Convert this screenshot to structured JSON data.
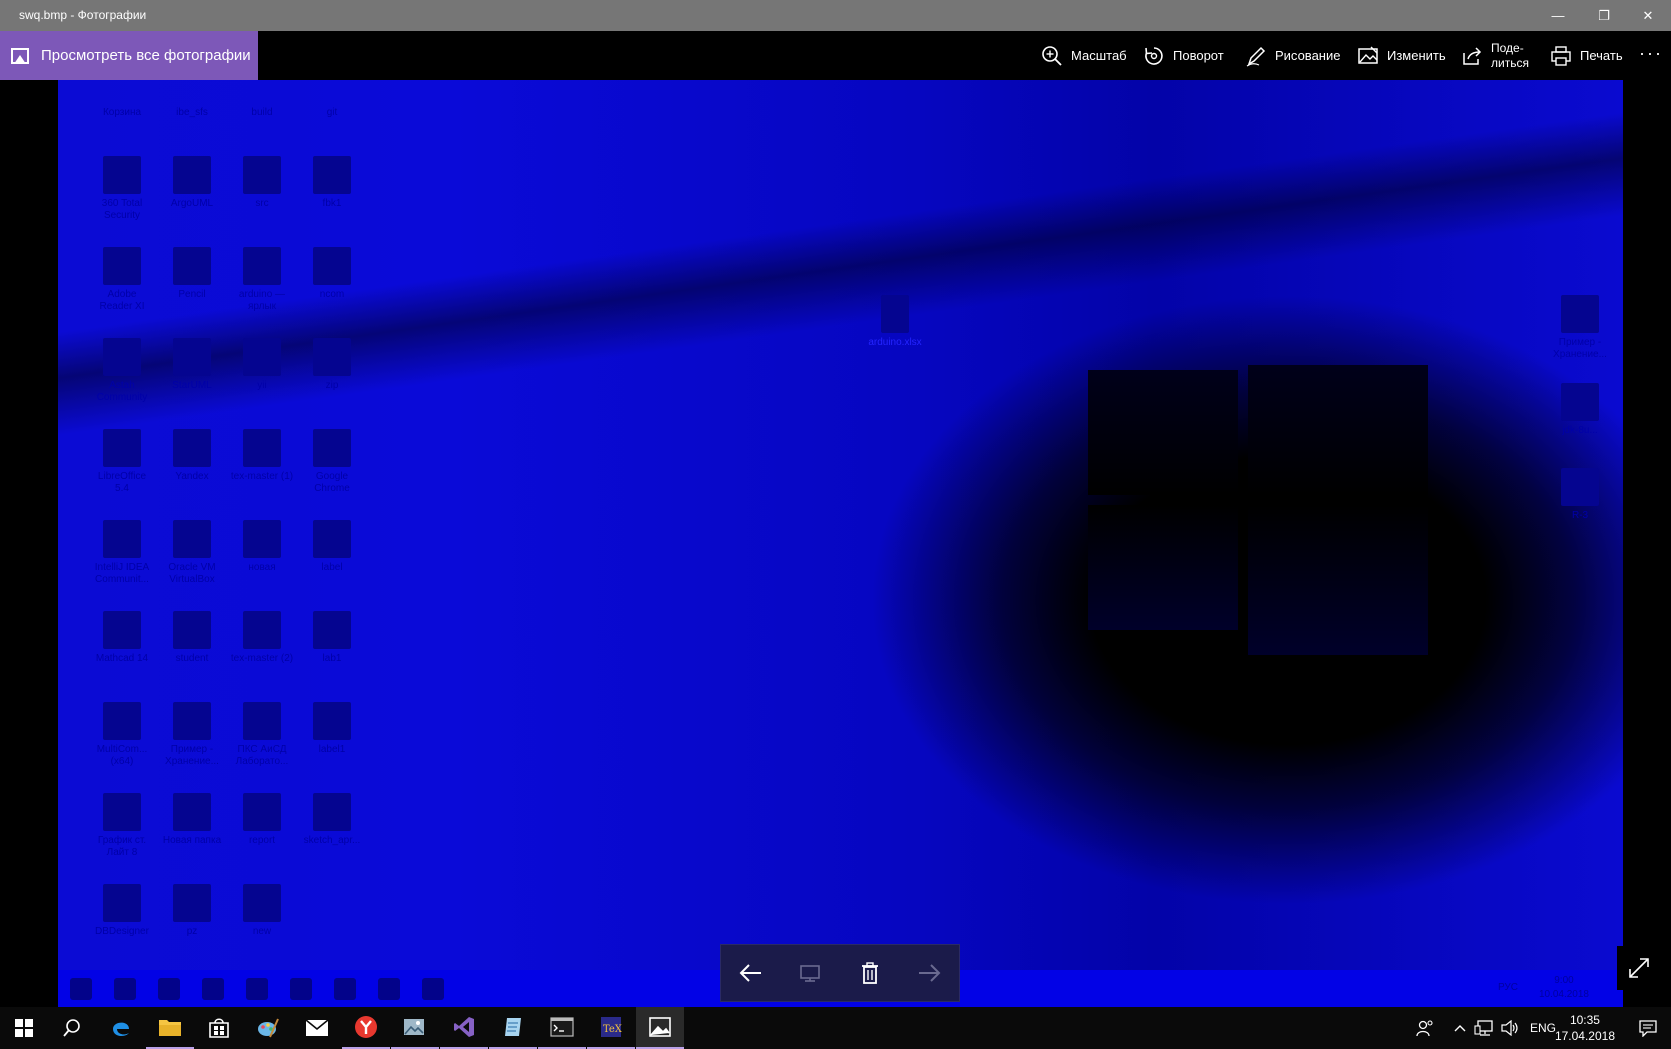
{
  "window": {
    "title": "swq.bmp - Фотографии",
    "minimize": "—",
    "restore": "❐",
    "close": "✕"
  },
  "toolbar": {
    "view_all": "Просмотреть все фотографии",
    "zoom": "Масштаб",
    "rotate": "Поворот",
    "draw": "Рисование",
    "edit": "Изменить",
    "share_line1": "Поде-",
    "share_line2": "литься",
    "print": "Печать",
    "more": "···"
  },
  "photo": {
    "desktop_icons": [
      {
        "label": "Корзина"
      },
      {
        "label": "ibe_sfs"
      },
      {
        "label": "build"
      },
      {
        "label": "git"
      },
      {
        "label": "360 Total Security"
      },
      {
        "label": "ArgoUML"
      },
      {
        "label": "src"
      },
      {
        "label": "fbk1"
      },
      {
        "label": "Adobe Reader XI"
      },
      {
        "label": "Pencil"
      },
      {
        "label": "arduino — ярлык"
      },
      {
        "label": "ncom"
      },
      {
        "label": "Astah Community"
      },
      {
        "label": "StarUML"
      },
      {
        "label": "yii"
      },
      {
        "label": "zip"
      },
      {
        "label": "LibreOffice 5.4"
      },
      {
        "label": "Yandex"
      },
      {
        "label": "tex-master (1)"
      },
      {
        "label": "Google Chrome"
      },
      {
        "label": "IntelliJ IDEA Communit..."
      },
      {
        "label": "Oracle VM VirtualBox"
      },
      {
        "label": "новая"
      },
      {
        "label": "label"
      },
      {
        "label": "Mathcad 14"
      },
      {
        "label": "student"
      },
      {
        "label": "tex-master (2)"
      },
      {
        "label": "lab1"
      },
      {
        "label": "MultiCom... (x64)"
      },
      {
        "label": "Пример - Хранение..."
      },
      {
        "label": "ПКС АиСД Лаборато..."
      },
      {
        "label": "label1"
      },
      {
        "label": "График ст. Лайт 8"
      },
      {
        "label": "Новая папка"
      },
      {
        "label": "report"
      },
      {
        "label": "sketch_apr..."
      },
      {
        "label": "DBDesigner"
      },
      {
        "label": "pz"
      },
      {
        "label": "new"
      }
    ],
    "center_icon": "arduino.xlsx",
    "right_icons": [
      {
        "label": "Пример - Хранение..."
      },
      {
        "label": "jdk-8u..."
      },
      {
        "label": "R-3"
      }
    ],
    "inner_clock_time": "9:00",
    "inner_clock_date": "10.04.2018",
    "inner_lang": "РУС"
  },
  "nav": {
    "back": "←",
    "slideshow": "▭",
    "delete": "🗑",
    "forward": "→",
    "fullscreen": "⤢"
  },
  "taskbar": {
    "lang": "ENG",
    "time": "10:35",
    "date": "17.04.2018"
  },
  "colors": {
    "accent": "#7d58b8",
    "photo_blue": "#0a0ad8",
    "titlebar": "#767676"
  }
}
